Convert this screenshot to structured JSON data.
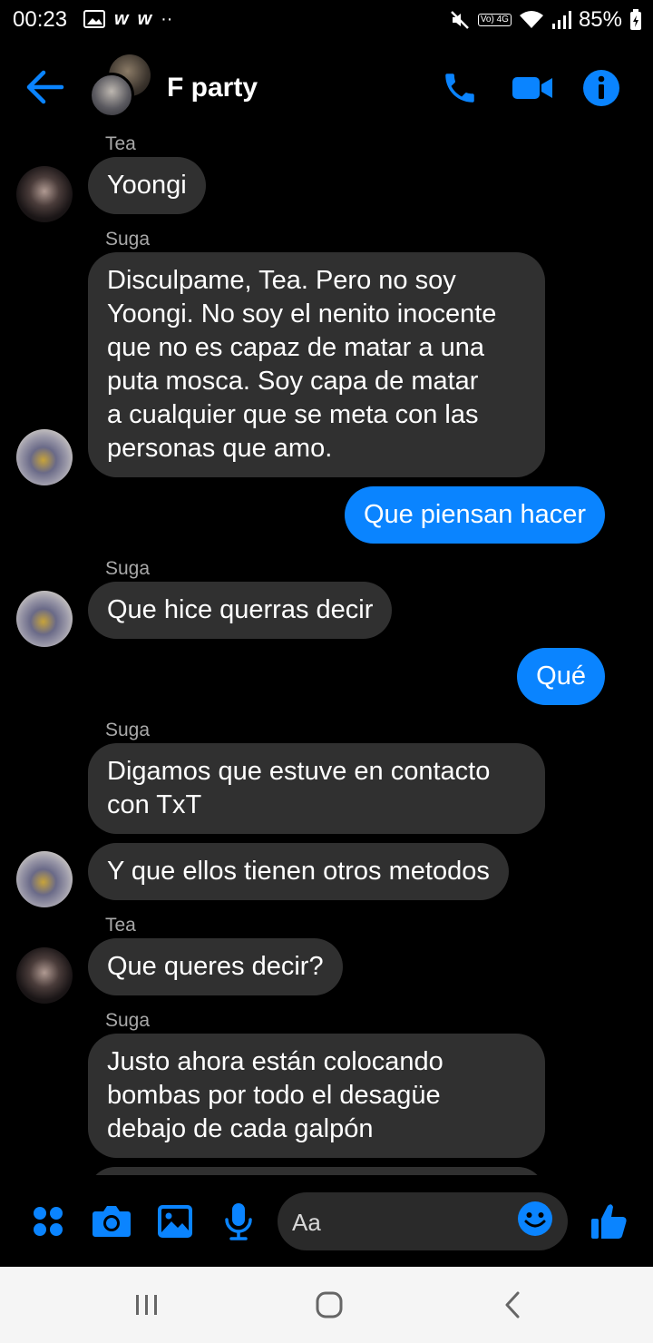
{
  "status_bar": {
    "time": "00:23",
    "battery": "85%",
    "network_label": "Vo) 4G",
    "left_icons": [
      "image-icon",
      "w-icon",
      "w-icon",
      "more-dots-icon"
    ],
    "right_icons": [
      "mute-icon",
      "volte-icon",
      "wifi-icon",
      "signal-icon",
      "battery-icon"
    ]
  },
  "header": {
    "title": "F party",
    "buttons": [
      "back-arrow-icon",
      "phone-icon",
      "video-icon",
      "info-icon"
    ]
  },
  "messages": [
    {
      "sender": "Tea",
      "direction": "in",
      "text": "Yoongi"
    },
    {
      "sender": "Suga",
      "direction": "in",
      "text": "Disculpame, Tea. Pero no soy\nYoongi. No soy el nenito inocente\nque no es capaz de matar a una\nputa mosca. Soy capa de matar\na cualquier que se meta con las\npersonas que amo."
    },
    {
      "sender": "",
      "direction": "out",
      "text": "Que piensan hacer"
    },
    {
      "sender": "Suga",
      "direction": "in",
      "text": "Que hice querras decir"
    },
    {
      "sender": "",
      "direction": "out",
      "text": "Qué"
    },
    {
      "sender": "Suga",
      "direction": "in",
      "text": "Digamos que estuve en contacto\ncon TxT"
    },
    {
      "sender": "",
      "direction": "in",
      "text": "Y que ellos tienen otros metodos"
    },
    {
      "sender": "Tea",
      "direction": "in",
      "text": "Que queres decir?"
    },
    {
      "sender": "Suga",
      "direction": "in",
      "text": "Justo ahora están colocando\nbombas por todo el desagüe\ndebajo de cada galpón"
    }
  ],
  "composer": {
    "placeholder": "Aa",
    "buttons": [
      "menu-dots-icon",
      "camera-icon",
      "gallery-icon",
      "microphone-icon",
      "emoji-icon",
      "like-icon"
    ]
  },
  "nav_bar": {
    "buttons": [
      "recent-apps-button",
      "home-button",
      "back-button"
    ]
  },
  "colors": {
    "accent": "#0a84ff",
    "incoming_bubble": "#303030",
    "background": "#000000",
    "sender_label": "#a8a8a8"
  }
}
